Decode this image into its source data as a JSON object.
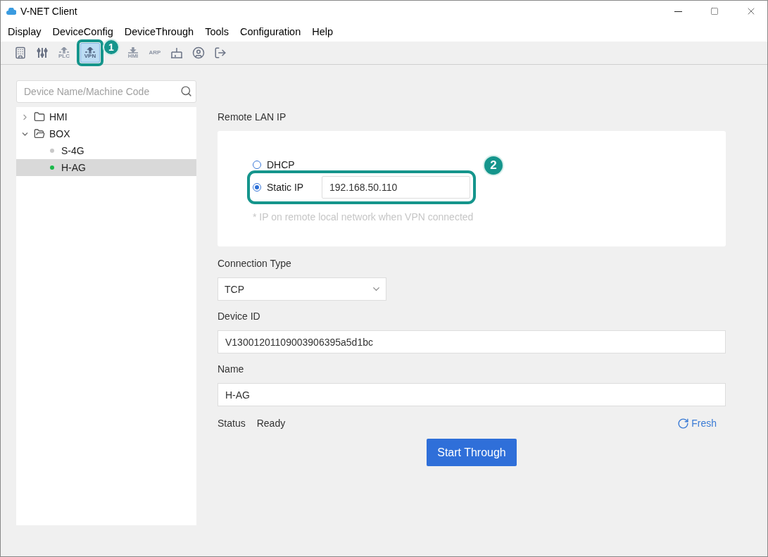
{
  "window": {
    "title": "V-NET Client"
  },
  "menu": [
    "Display",
    "DeviceConfig",
    "DeviceThrough",
    "Tools",
    "Configuration",
    "Help"
  ],
  "toolbar": [
    {
      "kind": "home",
      "selected": false
    },
    {
      "kind": "sliders",
      "selected": false
    },
    {
      "kind": "upload",
      "label": "PLC",
      "selected": false
    },
    {
      "kind": "upload",
      "label": "VPN",
      "selected": true,
      "callout": "1"
    },
    {
      "kind": "download",
      "label": "HMI",
      "selected": false
    },
    {
      "kind": "text",
      "label": "ARP",
      "selected": false
    },
    {
      "kind": "broom",
      "selected": false
    },
    {
      "kind": "user",
      "selected": false
    },
    {
      "kind": "logout",
      "selected": false
    }
  ],
  "sidebar": {
    "search": {
      "placeholder": "Device Name/Machine Code"
    },
    "tree": [
      {
        "label": "HMI",
        "expanded": false
      },
      {
        "label": "BOX",
        "expanded": true,
        "children": [
          {
            "label": "S-4G",
            "online": false,
            "selected": false
          },
          {
            "label": "H-AG",
            "online": true,
            "selected": true
          }
        ]
      }
    ]
  },
  "form": {
    "remote_lan_ip": {
      "label": "Remote LAN IP",
      "options": [
        {
          "label": "DHCP",
          "selected": false
        },
        {
          "label": "Static IP",
          "selected": true,
          "value": "192.168.50.110",
          "callout": "2"
        }
      ],
      "hint": "* IP on remote local network when VPN connected"
    },
    "connection_type": {
      "label": "Connection Type",
      "value": "TCP"
    },
    "device_id": {
      "label": "Device ID",
      "value": "V13001201109003906395a5d1bc"
    },
    "name": {
      "label": "Name",
      "value": "H-AG"
    },
    "status": {
      "label": "Status",
      "value": "Ready"
    },
    "refresh": "Fresh",
    "submit": "Start Through"
  }
}
